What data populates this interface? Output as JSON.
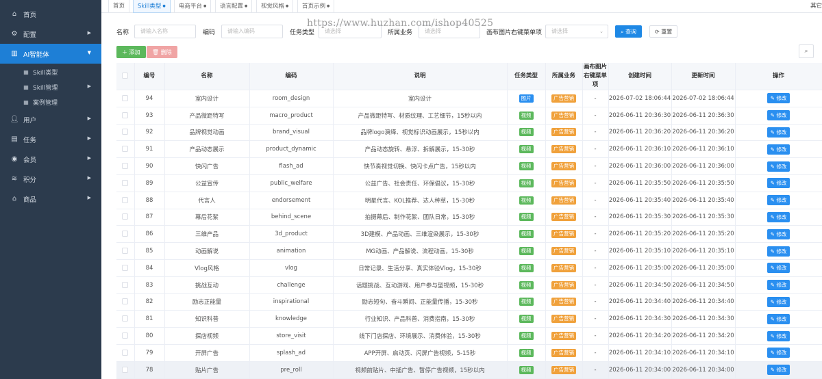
{
  "sidebar": {
    "items": [
      {
        "label": "首页"
      },
      {
        "label": "配置"
      },
      {
        "label": "AI智能体"
      },
      {
        "label": "用户"
      },
      {
        "label": "任务"
      },
      {
        "label": "会员"
      },
      {
        "label": "积分"
      },
      {
        "label": "商品"
      }
    ],
    "sub_items": [
      {
        "label": "Skill类型"
      },
      {
        "label": "Skill管理"
      },
      {
        "label": "案例管理"
      }
    ]
  },
  "tabs": [
    {
      "label": "首页"
    },
    {
      "label": "Skill类型"
    },
    {
      "label": "电商平台"
    },
    {
      "label": "语言配置"
    },
    {
      "label": "视觉风格"
    },
    {
      "label": "首页示例"
    }
  ],
  "tabs_more": "其它",
  "watermark": "https://www.huzhan.com/ishop40525",
  "search": {
    "name_label": "名称",
    "name_placeholder": "请输入名称",
    "code_label": "编码",
    "code_placeholder": "请输入编码",
    "type_label": "任务类型",
    "type_placeholder": "请选择",
    "biz_label": "所属业务",
    "biz_placeholder": "请选择",
    "menu_label": "画布图片右键菜单项",
    "menu_placeholder": "请选择",
    "query_label": "查询",
    "reset_label": "重置"
  },
  "toolbar": {
    "add_label": "添加",
    "delete_label": "删除"
  },
  "table": {
    "headers": {
      "id": "编号",
      "name": "名称",
      "code": "编码",
      "desc": "说明",
      "type": "任务类型",
      "biz": "所属业务",
      "menu": "画布图片右键菜单项",
      "created": "创建时间",
      "updated": "更新时间",
      "ops": "操作"
    },
    "edit_label": "修改",
    "rows": [
      {
        "id": "94",
        "name": "室内设计",
        "code": "room_design",
        "desc": "室内设计",
        "type": "图片",
        "biz": "广告营销",
        "menu": "-",
        "created": "2026-07-02 18:06:44",
        "updated": "2026-07-02 18:06:44"
      },
      {
        "id": "93",
        "name": "产品微距特写",
        "code": "macro_product",
        "desc": "产品微距特写、材质纹理、工艺细节，15秒以内",
        "type": "视频",
        "biz": "广告营销",
        "menu": "-",
        "created": "2026-06-11 20:36:30",
        "updated": "2026-06-11 20:36:30"
      },
      {
        "id": "92",
        "name": "品牌视觉动画",
        "code": "brand_visual",
        "desc": "品牌logo演绎、视觉标识动画展示，15秒以内",
        "type": "视频",
        "biz": "广告营销",
        "menu": "-",
        "created": "2026-06-11 20:36:20",
        "updated": "2026-06-11 20:36:20"
      },
      {
        "id": "91",
        "name": "产品动态展示",
        "code": "product_dynamic",
        "desc": "产品动态旋转、悬浮、拆解展示，15-30秒",
        "type": "视频",
        "biz": "广告营销",
        "menu": "-",
        "created": "2026-06-11 20:36:10",
        "updated": "2026-06-11 20:36:10"
      },
      {
        "id": "90",
        "name": "快闪广告",
        "code": "flash_ad",
        "desc": "快节奏视觉切换、快闪卡点广告，15秒以内",
        "type": "视频",
        "biz": "广告营销",
        "menu": "-",
        "created": "2026-06-11 20:36:00",
        "updated": "2026-06-11 20:36:00"
      },
      {
        "id": "89",
        "name": "公益宣传",
        "code": "public_welfare",
        "desc": "公益广告、社会责任、环保倡议，15-30秒",
        "type": "视频",
        "biz": "广告营销",
        "menu": "-",
        "created": "2026-06-11 20:35:50",
        "updated": "2026-06-11 20:35:50"
      },
      {
        "id": "88",
        "name": "代言人",
        "code": "endorsement",
        "desc": "明星代言、KOL推荐、达人种草，15-30秒",
        "type": "视频",
        "biz": "广告营销",
        "menu": "-",
        "created": "2026-06-11 20:35:40",
        "updated": "2026-06-11 20:35:40"
      },
      {
        "id": "87",
        "name": "幕后花絮",
        "code": "behind_scene",
        "desc": "拍摄幕后、制作花絮、团队日常，15-30秒",
        "type": "视频",
        "biz": "广告营销",
        "menu": "-",
        "created": "2026-06-11 20:35:30",
        "updated": "2026-06-11 20:35:30"
      },
      {
        "id": "86",
        "name": "三维产品",
        "code": "3d_product",
        "desc": "3D建模、产品动画、三维渲染展示，15-30秒",
        "type": "视频",
        "biz": "广告营销",
        "menu": "-",
        "created": "2026-06-11 20:35:20",
        "updated": "2026-06-11 20:35:20"
      },
      {
        "id": "85",
        "name": "动画解说",
        "code": "animation",
        "desc": "MG动画、产品解说、流程动画，15-30秒",
        "type": "视频",
        "biz": "广告营销",
        "menu": "-",
        "created": "2026-06-11 20:35:10",
        "updated": "2026-06-11 20:35:10"
      },
      {
        "id": "84",
        "name": "Vlog风格",
        "code": "vlog",
        "desc": "日常记录、生活分享、真实体验Vlog，15-30秒",
        "type": "视频",
        "biz": "广告营销",
        "menu": "-",
        "created": "2026-06-11 20:35:00",
        "updated": "2026-06-11 20:35:00"
      },
      {
        "id": "83",
        "name": "挑战互动",
        "code": "challenge",
        "desc": "话题挑战、互动游戏、用户参与型视频，15-30秒",
        "type": "视频",
        "biz": "广告营销",
        "menu": "-",
        "created": "2026-06-11 20:34:50",
        "updated": "2026-06-11 20:34:50"
      },
      {
        "id": "82",
        "name": "励志正能量",
        "code": "inspirational",
        "desc": "励志短句、奋斗瞬间、正能量传播，15-30秒",
        "type": "视频",
        "biz": "广告营销",
        "menu": "-",
        "created": "2026-06-11 20:34:40",
        "updated": "2026-06-11 20:34:40"
      },
      {
        "id": "81",
        "name": "知识科普",
        "code": "knowledge",
        "desc": "行业知识、产品科普、消费指南，15-30秒",
        "type": "视频",
        "biz": "广告营销",
        "menu": "-",
        "created": "2026-06-11 20:34:30",
        "updated": "2026-06-11 20:34:30"
      },
      {
        "id": "80",
        "name": "探店视频",
        "code": "store_visit",
        "desc": "线下门店探店、环境展示、消费体验，15-30秒",
        "type": "视频",
        "biz": "广告营销",
        "menu": "-",
        "created": "2026-06-11 20:34:20",
        "updated": "2026-06-11 20:34:20"
      },
      {
        "id": "79",
        "name": "开屏广告",
        "code": "splash_ad",
        "desc": "APP开屏、启动页、闪屏广告视频，5-15秒",
        "type": "视频",
        "biz": "广告营销",
        "menu": "-",
        "created": "2026-06-11 20:34:10",
        "updated": "2026-06-11 20:34:10"
      },
      {
        "id": "78",
        "name": "贴片广告",
        "code": "pre_roll",
        "desc": "视频前贴片、中插广告、暂停广告视频，15秒以内",
        "type": "视频",
        "biz": "广告营销",
        "menu": "-",
        "created": "2026-06-11 20:34:00",
        "updated": "2026-06-11 20:34:00"
      }
    ]
  },
  "colors": {
    "sidebar_bg": "#2c3b4d",
    "accent": "#1e7fd6",
    "tag_image": "#2a8ff0",
    "tag_video": "#5cb85c",
    "tag_biz": "#f0a13b"
  }
}
